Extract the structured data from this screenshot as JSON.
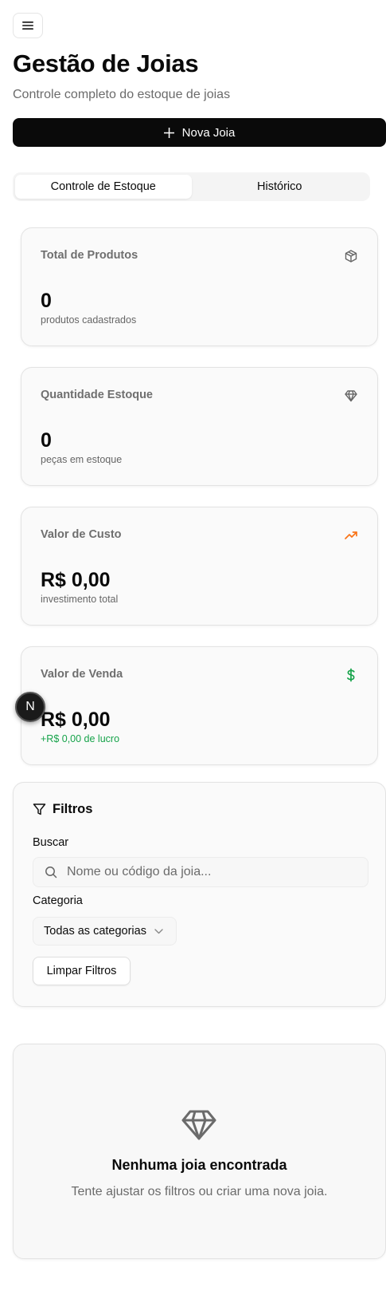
{
  "header": {
    "title": "Gestão de Joias",
    "subtitle": "Controle completo do estoque de joias",
    "menu_icon": "menu-icon",
    "new_button_label": "Nova Joia"
  },
  "tabs": [
    {
      "label": "Controle de Estoque",
      "active": true
    },
    {
      "label": "Histórico",
      "active": false
    }
  ],
  "stats": [
    {
      "title": "Total de Produtos",
      "value": "0",
      "sub": "produtos cadastrados",
      "icon": "box-icon"
    },
    {
      "title": "Quantidade Estoque",
      "value": "0",
      "sub": "peças em estoque",
      "icon": "gem-icon"
    },
    {
      "title": "Valor de Custo",
      "value": "R$ 0,00",
      "sub": "investimento total",
      "icon": "trending-up-icon",
      "icon_color": "#f97316"
    },
    {
      "title": "Valor de Venda",
      "value": "R$ 0,00",
      "sub": "+R$ 0,00 de lucro",
      "icon": "dollar-icon",
      "icon_color": "#16a34a",
      "sub_color": "#16a34a"
    }
  ],
  "floating_badge": {
    "label": "N"
  },
  "filters": {
    "title": "Filtros",
    "search_label": "Buscar",
    "search_placeholder": "Nome ou código da joia...",
    "search_value": "",
    "category_label": "Categoria",
    "category_selected": "Todas as categorias",
    "clear_button_label": "Limpar Filtros"
  },
  "empty_state": {
    "title": "Nenhuma joia encontrada",
    "message": "Tente ajustar os filtros ou criar uma nova joia."
  }
}
